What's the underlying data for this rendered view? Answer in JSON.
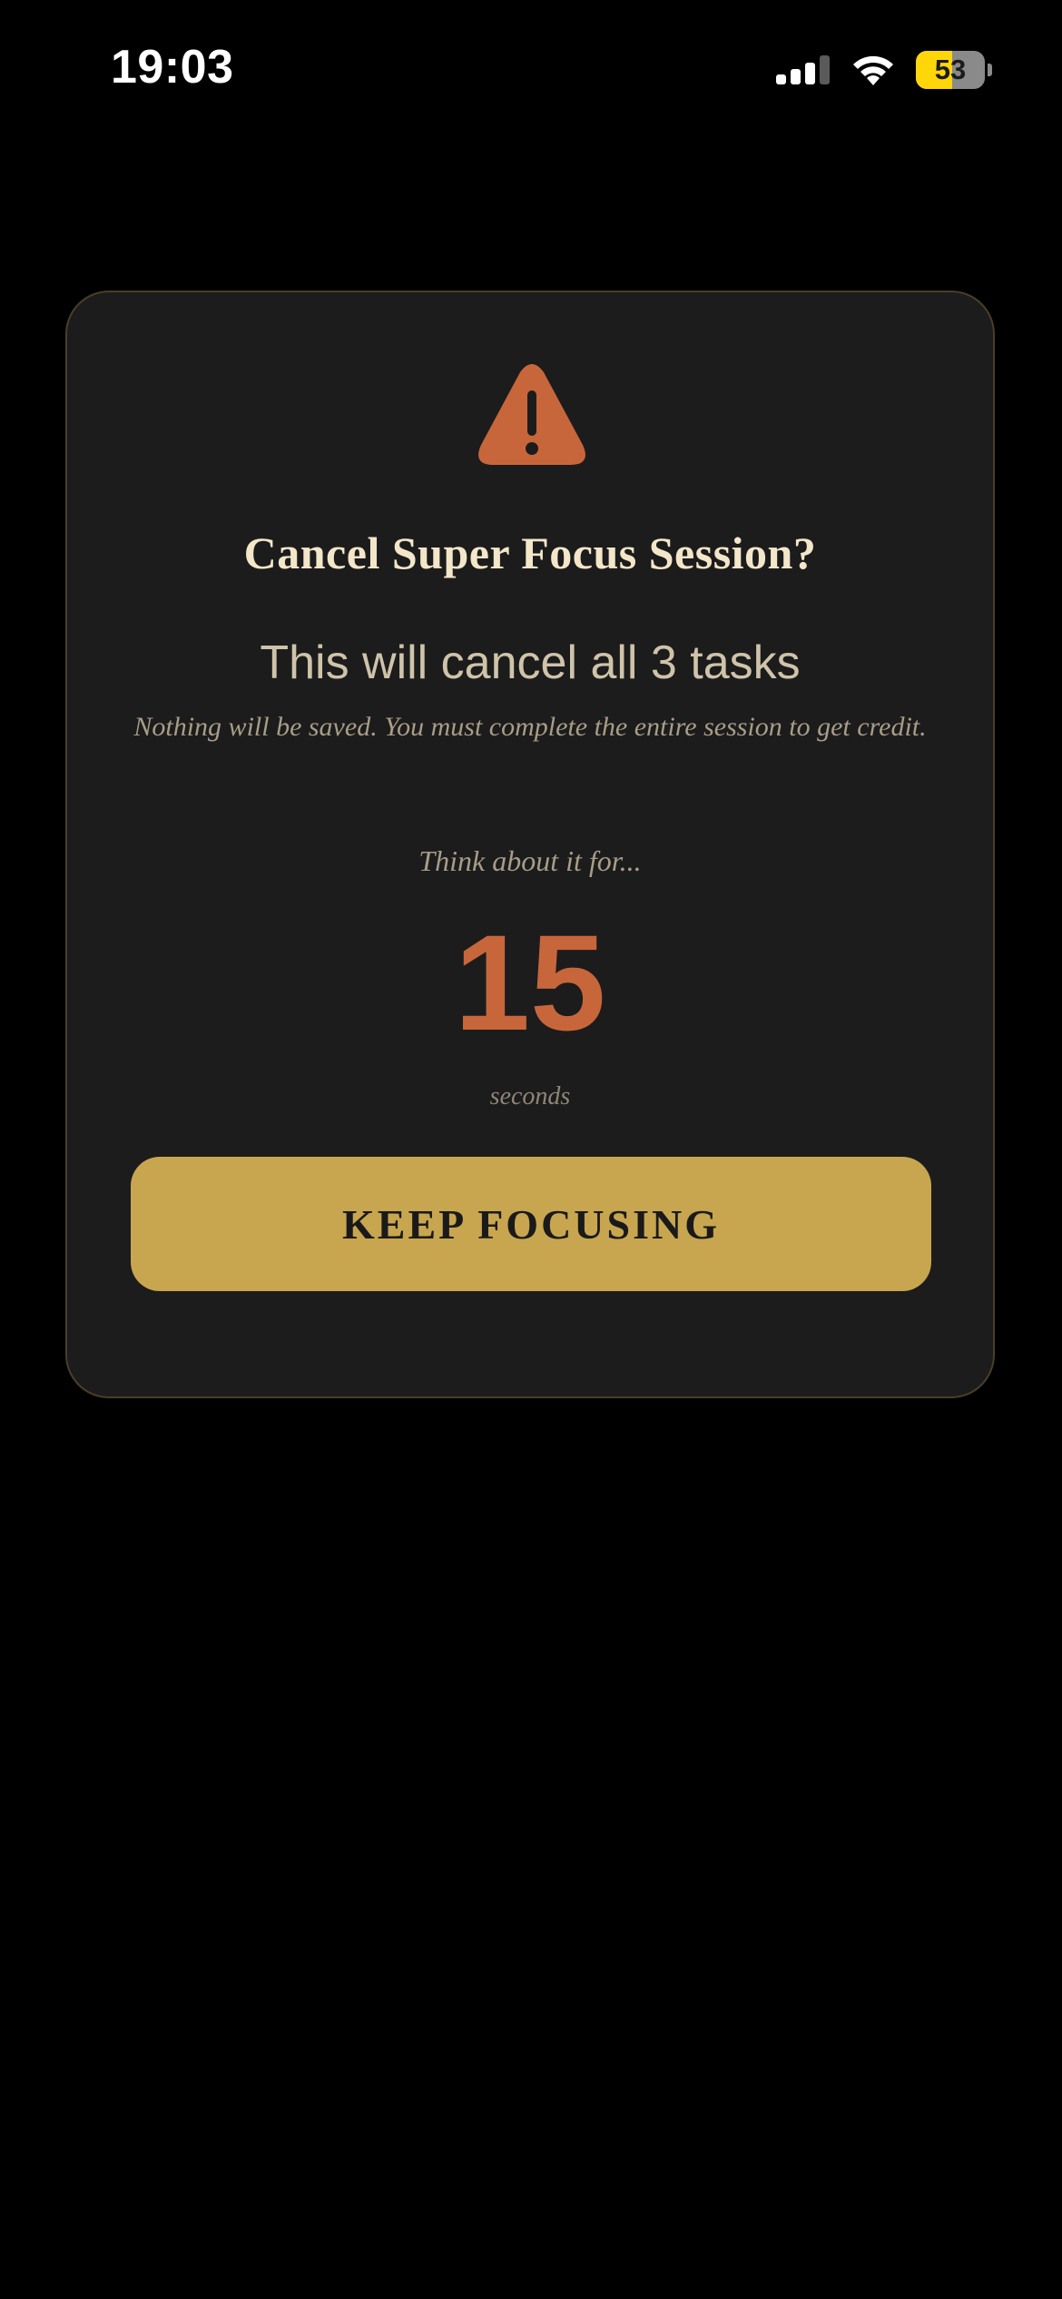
{
  "status_bar": {
    "time": "19:03",
    "battery_level": "53",
    "battery_fraction": 0.53,
    "signal_icon": "cellular-signal-icon",
    "wifi_icon": "wifi-icon",
    "battery_icon": "battery-icon"
  },
  "modal": {
    "icon": "warning-triangle-icon",
    "icon_color": "#c8663b",
    "title": "Cancel Super Focus Session?",
    "subtitle": "This will cancel all 3 tasks",
    "warning": "Nothing will be saved. You must complete the entire session to get credit.",
    "think_label": "Think about it for...",
    "countdown_value": "15",
    "countdown_unit": "seconds",
    "keep_button_label": "KEEP FOCUSING",
    "accent_color": "#c8a54f"
  }
}
